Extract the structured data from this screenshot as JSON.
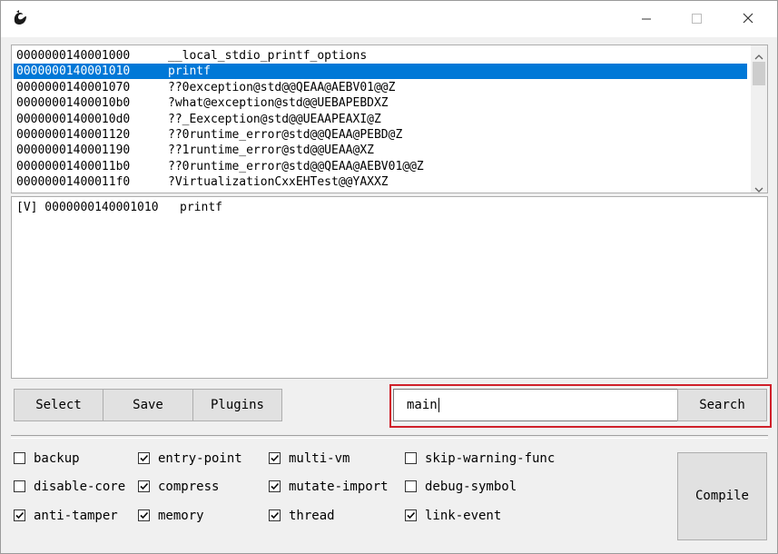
{
  "window": {
    "icon": "dragon-icon",
    "controls": {
      "minimize": "─",
      "maximize": "☐",
      "close": "✕"
    }
  },
  "functions": [
    {
      "address": "0000000140001000",
      "name": "__local_stdio_printf_options",
      "selected": false
    },
    {
      "address": "0000000140001010",
      "name": "printf",
      "selected": true
    },
    {
      "address": "0000000140001070",
      "name": "??0exception@std@@QEAA@AEBV01@@Z",
      "selected": false
    },
    {
      "address": "00000001400010b0",
      "name": "?what@exception@std@@UEBAPEBDXZ",
      "selected": false
    },
    {
      "address": "00000001400010d0",
      "name": "??_Eexception@std@@UEAAPEAXI@Z",
      "selected": false
    },
    {
      "address": "0000000140001120",
      "name": "??0runtime_error@std@@QEAA@PEBD@Z",
      "selected": false
    },
    {
      "address": "0000000140001190",
      "name": "??1runtime_error@std@@UEAA@XZ",
      "selected": false
    },
    {
      "address": "00000001400011b0",
      "name": "??0runtime_error@std@@QEAA@AEBV01@@Z",
      "selected": false
    },
    {
      "address": "00000001400011f0",
      "name": "?VirtualizationCxxEHTest@@YAXXZ",
      "selected": false
    }
  ],
  "output": {
    "lines": [
      "[V] 0000000140001010   printf"
    ]
  },
  "toolbar": {
    "select_label": "Select",
    "save_label": "Save",
    "plugins_label": "Plugins"
  },
  "search": {
    "value": "main",
    "button_label": "Search",
    "highlight_color": "#d0202a"
  },
  "options": [
    {
      "key": "backup",
      "label": "backup",
      "checked": false
    },
    {
      "key": "disable-core",
      "label": "disable-core",
      "checked": false
    },
    {
      "key": "anti-tamper",
      "label": "anti-tamper",
      "checked": true
    },
    {
      "key": "entry-point",
      "label": "entry-point",
      "checked": true
    },
    {
      "key": "compress",
      "label": "compress",
      "checked": true
    },
    {
      "key": "memory",
      "label": "memory",
      "checked": true
    },
    {
      "key": "multi-vm",
      "label": "multi-vm",
      "checked": true
    },
    {
      "key": "mutate-import",
      "label": "mutate-import",
      "checked": true
    },
    {
      "key": "thread",
      "label": "thread",
      "checked": true
    },
    {
      "key": "skip-warning-func",
      "label": "skip-warning-func",
      "checked": false
    },
    {
      "key": "debug-symbol",
      "label": "debug-symbol",
      "checked": false
    },
    {
      "key": "link-event",
      "label": "link-event",
      "checked": true
    }
  ],
  "compile": {
    "label": "Compile"
  },
  "colors": {
    "selection": "#0078d7",
    "button_face": "#e1e1e1",
    "window_bg": "#f0f0f0"
  }
}
